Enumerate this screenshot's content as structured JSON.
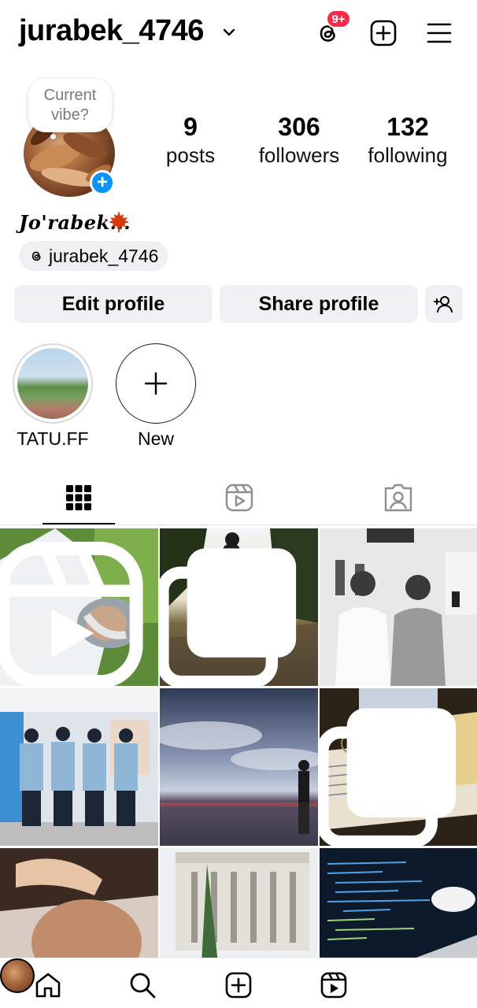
{
  "header": {
    "username": "jurabek_4746",
    "notification_badge": "9+",
    "icons": [
      "chevron-down-icon",
      "threads-icon",
      "create-post-icon",
      "menu-icon"
    ]
  },
  "profile": {
    "vibe_prompt_line1": "Current",
    "vibe_prompt_line2": "vibe?",
    "stats": {
      "posts_count": "9",
      "posts_label": "posts",
      "followers_count": "306",
      "followers_label": "followers",
      "following_count": "132",
      "following_label": "following"
    },
    "bio_name": "Jo'rabek...",
    "threads_handle": "jurabek_4746"
  },
  "actions": {
    "edit_profile": "Edit profile",
    "share_profile": "Share profile"
  },
  "highlights": [
    {
      "label": "TATU.FF"
    },
    {
      "label": "New"
    }
  ],
  "tabs": [
    "grid-icon",
    "reels-icon",
    "tagged-icon"
  ],
  "grid_posts": [
    {
      "type": "reel"
    },
    {
      "type": "carousel"
    },
    {
      "type": "photo"
    },
    {
      "type": "photo"
    },
    {
      "type": "photo"
    },
    {
      "type": "carousel"
    },
    {
      "type": "photo"
    },
    {
      "type": "photo"
    },
    {
      "type": "photo"
    }
  ],
  "bottom_nav": [
    "home-icon",
    "search-icon",
    "create-icon",
    "reels-icon",
    "profile-avatar"
  ],
  "colors": {
    "accent_blue": "#0a95f6",
    "badge_red": "#ff2a45",
    "button_bg": "#eef0f3"
  }
}
